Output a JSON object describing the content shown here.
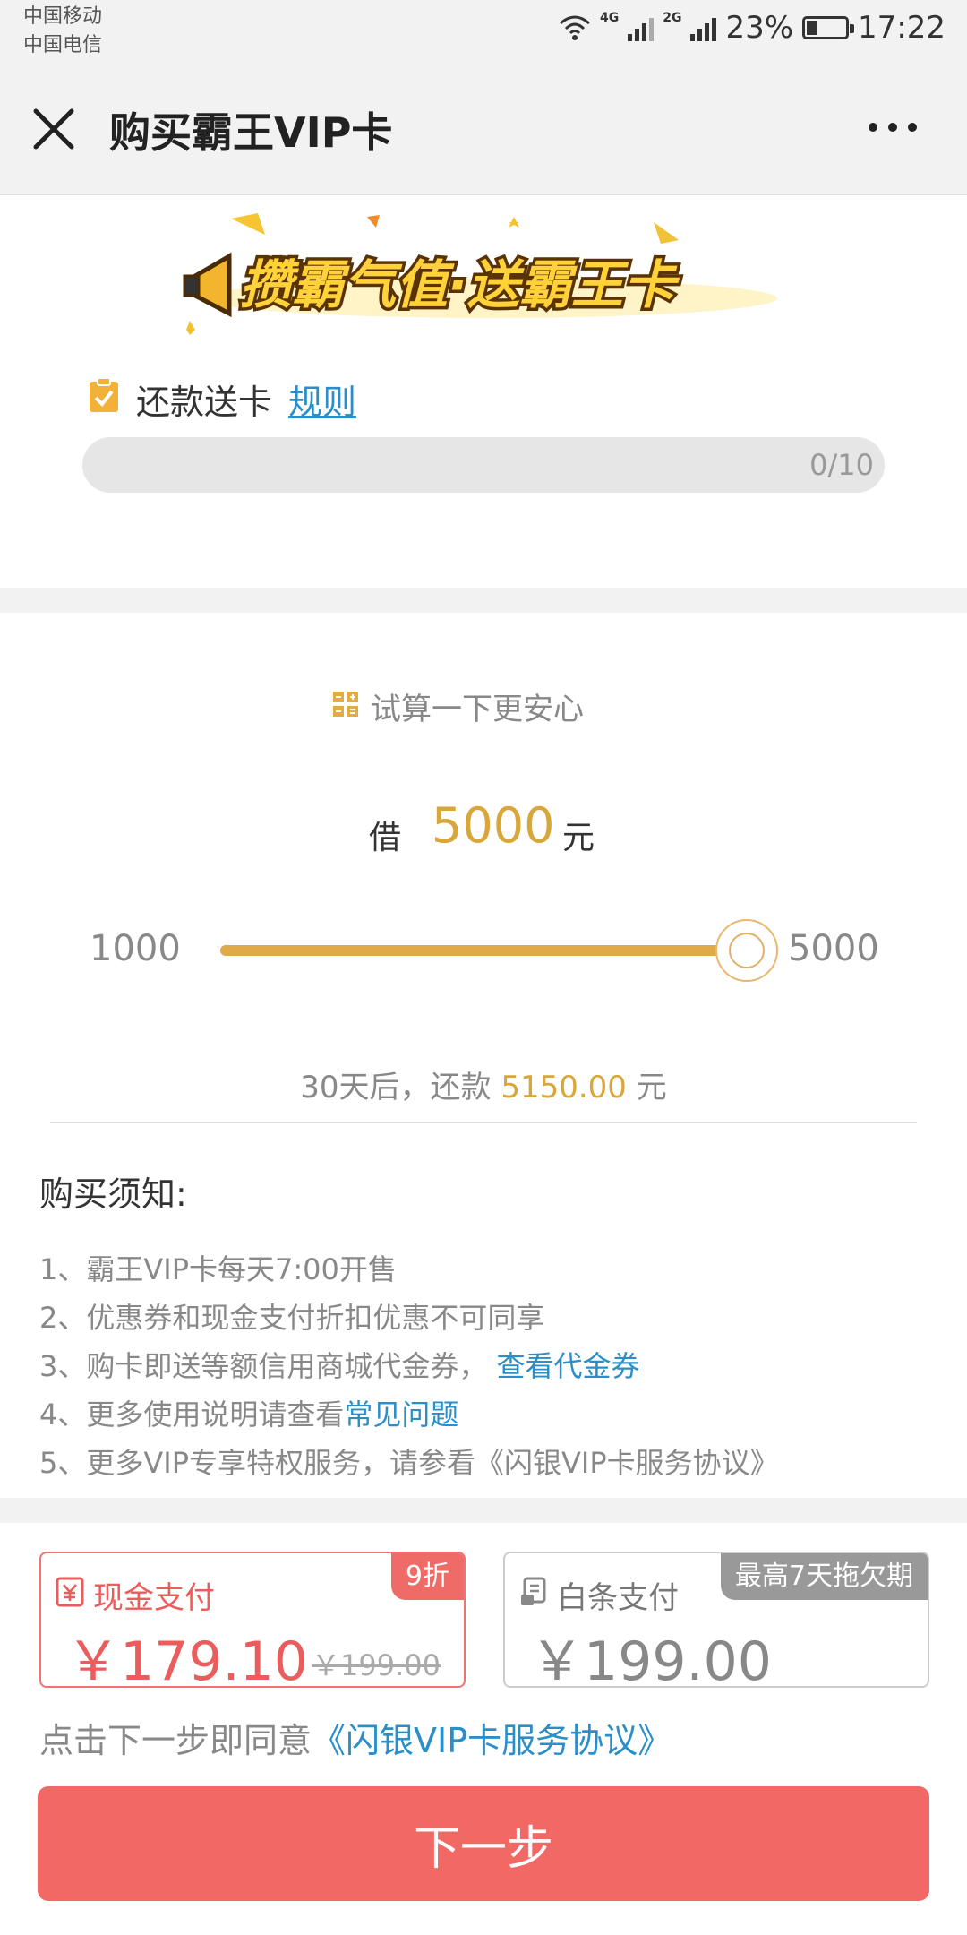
{
  "status_bar": {
    "carrier1": "中国移动",
    "carrier2": "中国电信",
    "net1": "4G",
    "net2": "2G",
    "battery": "23%",
    "time": "17:22"
  },
  "nav": {
    "title": "购买霸王VIP卡",
    "close_icon": "close-icon",
    "more_icon": "more-icon"
  },
  "promo": {
    "banner_text": "攒霸气值·送霸王卡",
    "repay_label": "还款送卡",
    "rule_link": "规则",
    "progress_text": "0/10",
    "progress_current": 0,
    "progress_total": 10
  },
  "calculator": {
    "title": "试算一下更安心",
    "borrow_prefix": "借",
    "borrow_amount": "5000",
    "borrow_unit": "元",
    "slider_min": "1000",
    "slider_max": "5000",
    "slider_value": 5000,
    "repay_prefix": "30天后，还款",
    "repay_amount": "5150.00",
    "repay_unit": "元"
  },
  "notice": {
    "title": "购买须知:",
    "items": [
      {
        "text": "1、霸王VIP卡每天7:00开售",
        "link": ""
      },
      {
        "text": "2、优惠券和现金支付折扣优惠不可同享",
        "link": ""
      },
      {
        "text": "3、购卡即送等额信用商城代金券，",
        "link": "查看代金券"
      },
      {
        "text": "4、更多使用说明请查看",
        "link": "常见问题"
      },
      {
        "text": "5、更多VIP专享特权服务，请参看《闪银VIP卡服务协议》",
        "link": ""
      }
    ]
  },
  "payment": {
    "cash": {
      "label": "现金支付",
      "badge": "9折",
      "price": "￥179.10",
      "original_price": "￥199.00"
    },
    "credit": {
      "label": "白条支付",
      "badge": "最高7天拖欠期",
      "price": "￥199.00"
    },
    "agree_prefix": "点击下一步即同意",
    "agree_link": "《闪银VIP卡服务协议》",
    "next_button": "下一步"
  },
  "colors": {
    "accent_gold": "#d9a63a",
    "accent_red": "#f26864",
    "link_blue": "#2a8fc9"
  }
}
